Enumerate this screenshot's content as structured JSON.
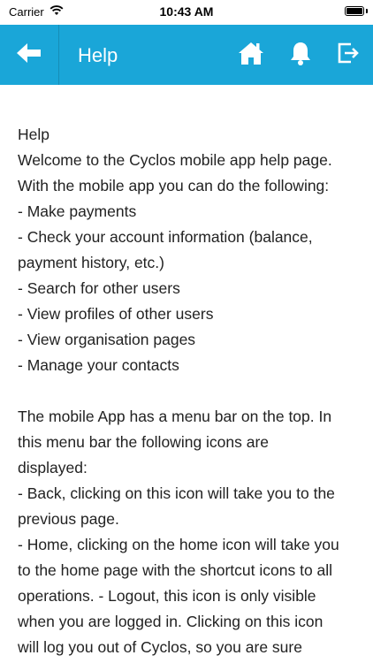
{
  "status_bar": {
    "carrier": "Carrier",
    "time": "10:43 AM"
  },
  "app_bar": {
    "title": "Help",
    "icons": [
      "back-arrow",
      "home",
      "bell",
      "logout"
    ],
    "color": "#1aa6d8"
  },
  "content": {
    "lines_1": [
      "Help",
      "Welcome to the Cyclos mobile app help page.",
      "With the mobile app you can do the following:",
      "- Make payments",
      "- Check your account information (balance,",
      "payment history, etc.)",
      "- Search for other users",
      "- View profiles of other users",
      "- View organisation pages",
      "- Manage your contacts"
    ],
    "lines_2": [
      "The mobile App has a menu bar on the top. In",
      "this menu bar the following icons are",
      "displayed:",
      "- Back, clicking on this icon will take you to the",
      "previous page.",
      "- Home, clicking on the home icon will take you",
      "to the home page with the shortcut icons to all",
      "operations. - Logout, this icon is only visible",
      "when you are logged in. Clicking on this icon",
      "will log you out of Cyclos, so you are sure"
    ]
  }
}
